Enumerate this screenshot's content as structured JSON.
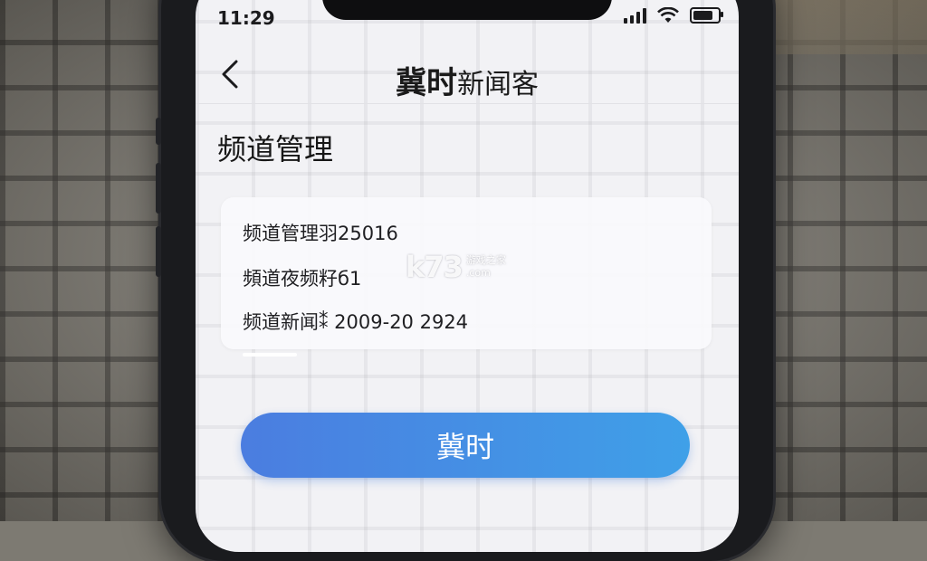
{
  "status_bar": {
    "time": "11:29",
    "signal_bars": 4,
    "battery_level": 0.8
  },
  "nav": {
    "title_bold": "冀时",
    "title_rest": "新闻客"
  },
  "page": {
    "title": "频道管理"
  },
  "channel_list": [
    {
      "text": "频道管理羽25016"
    },
    {
      "text": "頻道夜频籽б1"
    },
    {
      "text": "频道新闻⁑ 2009-20 2924"
    }
  ],
  "watermark": {
    "logo": "k73",
    "line1": "游戏之家",
    "line2": ".com"
  },
  "primary_button": {
    "label": "冀时"
  },
  "colors": {
    "button_start": "#4b7de0",
    "button_end": "#3fa0e8"
  }
}
